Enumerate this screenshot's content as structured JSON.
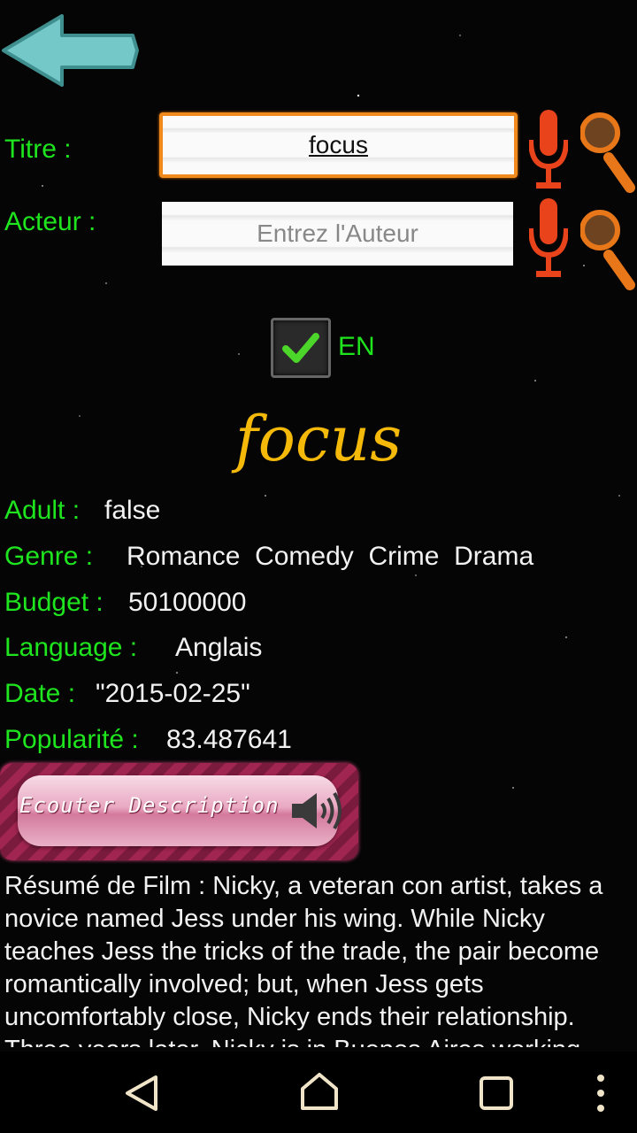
{
  "search": {
    "title_label": "Titre :",
    "title_value": "focus",
    "actor_label": "Acteur :",
    "actor_placeholder": "Entrez l'Auteur",
    "lang_checkbox_checked": true,
    "lang_label": "EN"
  },
  "movie": {
    "title": "focus",
    "fields": {
      "adult_label": "Adult :",
      "adult_value": "false",
      "genre_label": "Genre :",
      "genre_value": "Romance  Comedy  Crime  Drama",
      "budget_label": "Budget :",
      "budget_value": "50100000",
      "language_label": "Language :",
      "language_value": "Anglais",
      "date_label": "Date :",
      "date_value": "\"2015-02-25\"",
      "popularity_label": "Popularité :",
      "popularity_value": "83.487641"
    },
    "listen_button_label": "Ecouter Description",
    "summary": "Résumé de Film :  Nicky, a veteran con artist, takes a novice named Jess under his wing. While Nicky teaches Jess the tricks of the trade, the pair become romantically involved; but, when Jess gets uncomfortably close, Nicky ends their relationship. Three years later, Nicky is in Buenos Aires working"
  },
  "colors": {
    "label_green": "#1ee51e",
    "title_gold": "#f5b90a",
    "accent_orange": "#f08a1c",
    "arrow_teal": "#74c8c8"
  }
}
